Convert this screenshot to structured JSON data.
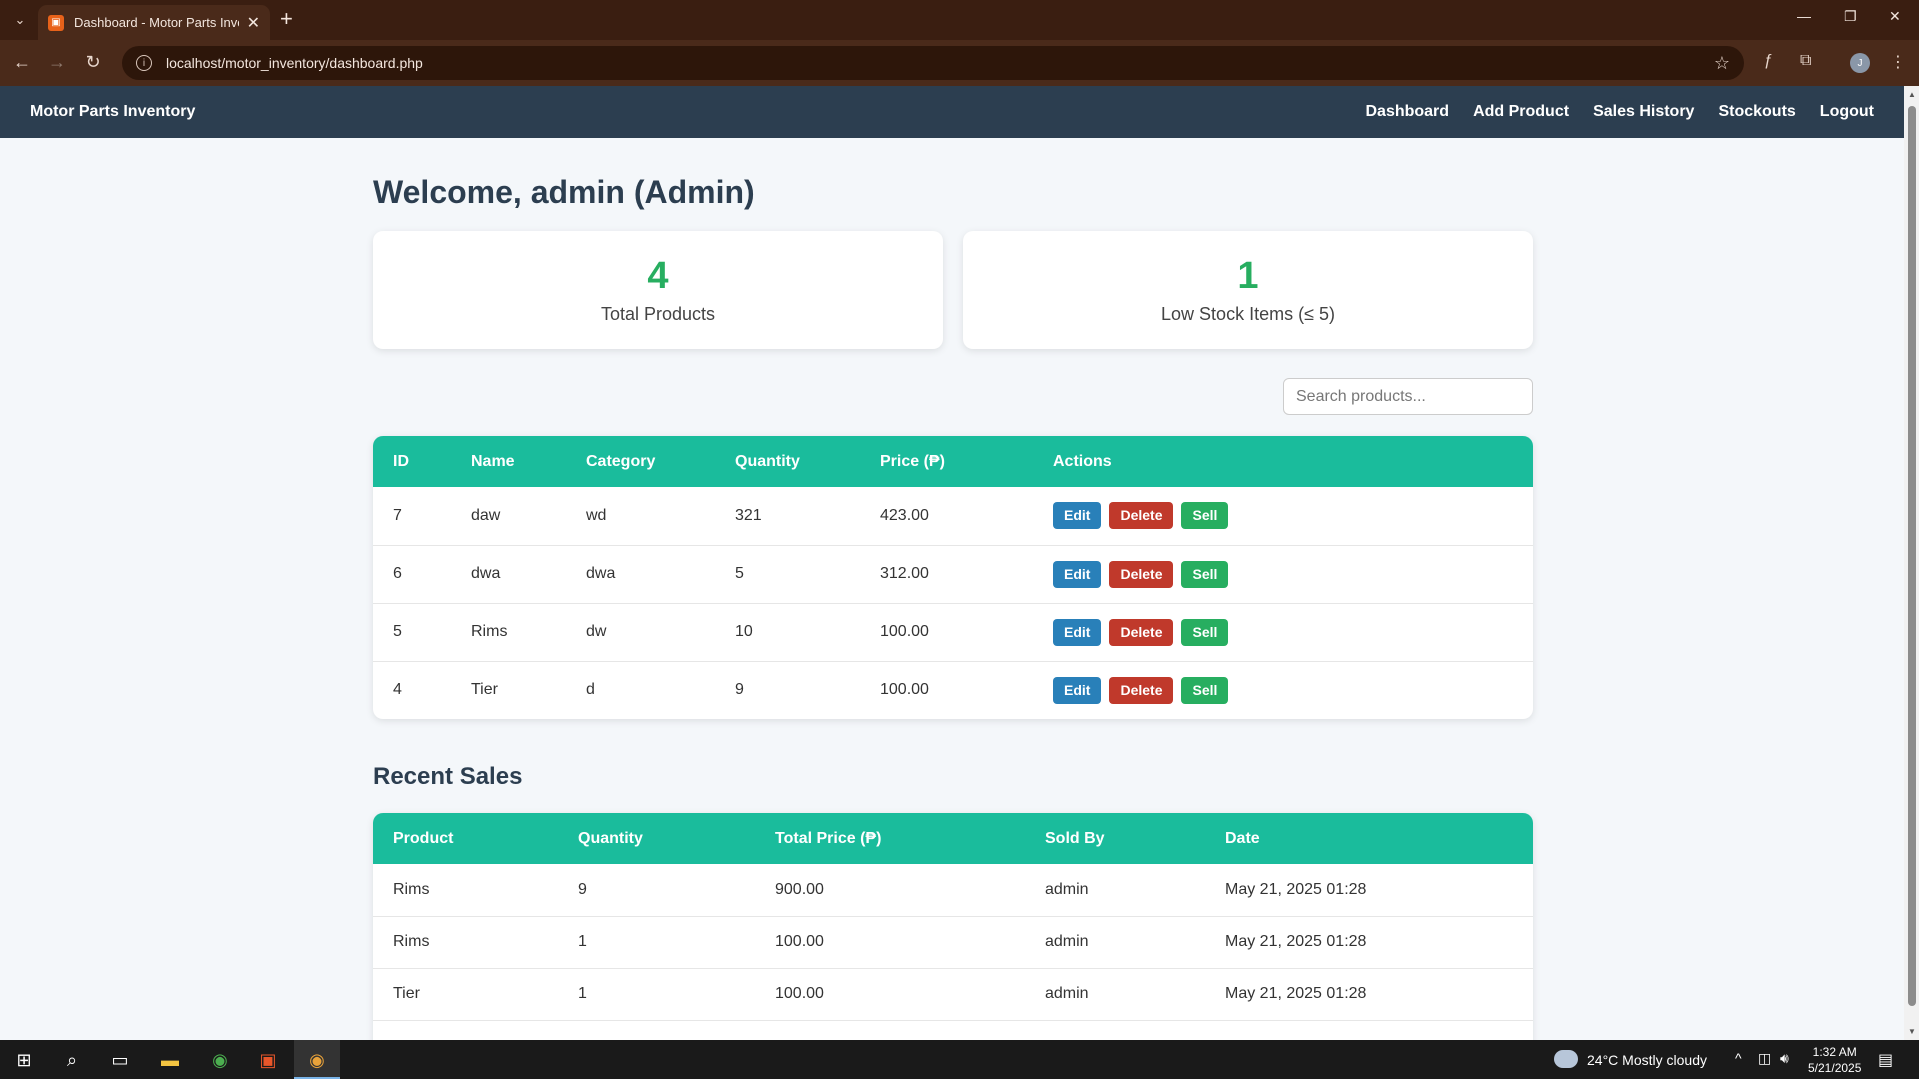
{
  "browser": {
    "tab_title": "Dashboard - Motor Parts Invent",
    "url": "localhost/motor_inventory/dashboard.php",
    "profile_initial": "J"
  },
  "nav": {
    "brand": "Motor Parts Inventory",
    "links": [
      "Dashboard",
      "Add Product",
      "Sales History",
      "Stockouts",
      "Logout"
    ]
  },
  "welcome": "Welcome, admin (Admin)",
  "stats": [
    {
      "value": "4",
      "label": "Total Products"
    },
    {
      "value": "1",
      "label": "Low Stock Items (≤ 5)"
    }
  ],
  "search": {
    "placeholder": "Search products..."
  },
  "products": {
    "headers": [
      "ID",
      "Name",
      "Category",
      "Quantity",
      "Price (₱)",
      "Actions"
    ],
    "actions": {
      "edit": "Edit",
      "delete": "Delete",
      "sell": "Sell"
    },
    "rows": [
      {
        "id": "7",
        "name": "daw",
        "category": "wd",
        "quantity": "321",
        "price": "423.00"
      },
      {
        "id": "6",
        "name": "dwa",
        "category": "dwa",
        "quantity": "5",
        "price": "312.00"
      },
      {
        "id": "5",
        "name": "Rims",
        "category": "dw",
        "quantity": "10",
        "price": "100.00"
      },
      {
        "id": "4",
        "name": "Tier",
        "category": "d",
        "quantity": "9",
        "price": "100.00"
      }
    ]
  },
  "sales": {
    "title": "Recent Sales",
    "headers": [
      "Product",
      "Quantity",
      "Total Price (₱)",
      "Sold By",
      "Date"
    ],
    "rows": [
      {
        "product": "Rims",
        "quantity": "9",
        "total": "900.00",
        "sold_by": "admin",
        "date": "May 21, 2025 01:28"
      },
      {
        "product": "Rims",
        "quantity": "1",
        "total": "100.00",
        "sold_by": "admin",
        "date": "May 21, 2025 01:28"
      },
      {
        "product": "Tier",
        "quantity": "1",
        "total": "100.00",
        "sold_by": "admin",
        "date": "May 21, 2025 01:28"
      }
    ]
  },
  "taskbar": {
    "weather": "24°C  Mostly cloudy",
    "time": "1:32 AM",
    "date": "5/21/2025"
  },
  "colors": {
    "nav_bg": "#2c3e50",
    "table_header": "#1abc9c",
    "stat_value": "#27ae60",
    "edit": "#2980b9",
    "delete": "#c0392b",
    "sell": "#27ae60"
  }
}
